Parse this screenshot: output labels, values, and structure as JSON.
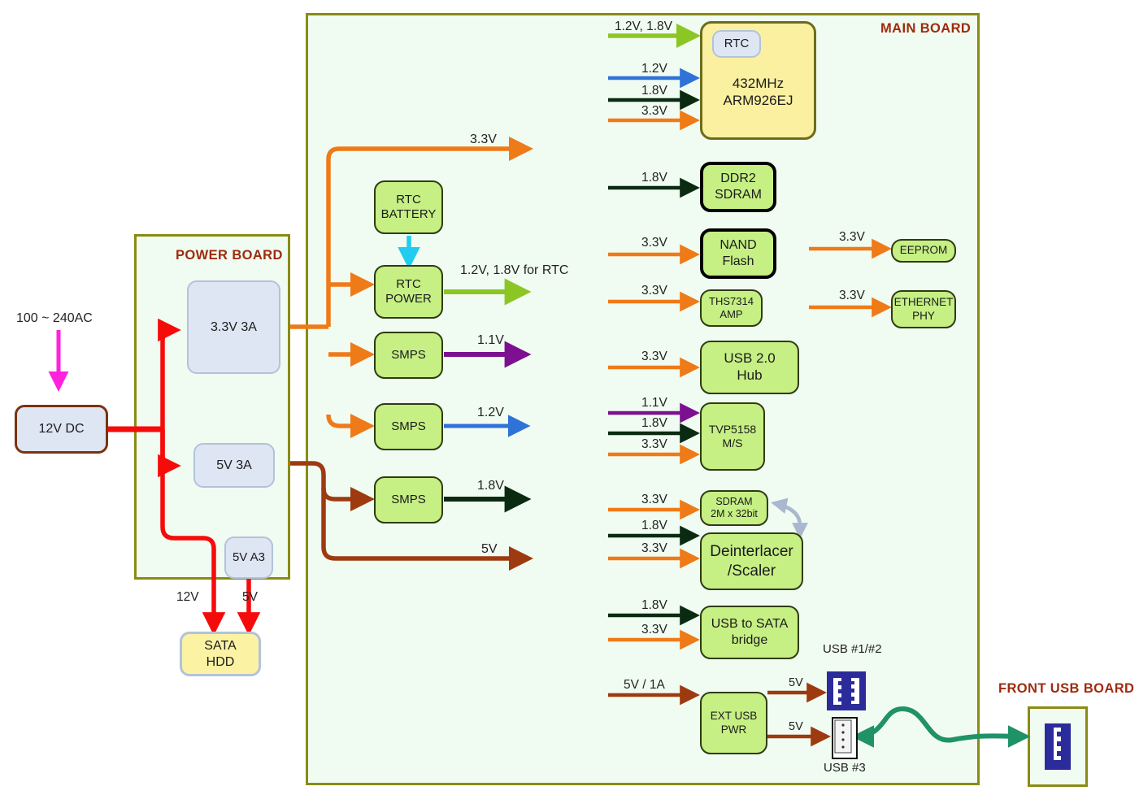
{
  "diagram": {
    "title": "Power distribution block diagram",
    "boards": [
      {
        "id": "power-board",
        "label": "POWER BOARD"
      },
      {
        "id": "main-board",
        "label": "MAIN BOARD"
      },
      {
        "id": "front-usb-board",
        "label": "FRONT  USB BOARD"
      }
    ]
  },
  "input": {
    "ac_label": "100 ~ 240AC",
    "dc_brick": "12V DC"
  },
  "power_board": {
    "rail_3v3": "3.3V 3A",
    "rail_5v": "5V 3A",
    "rail_5v_a3": "5V A3",
    "out_12v": "12V",
    "out_5v": "5V",
    "sata": {
      "line1": "SATA",
      "line2": "HDD"
    }
  },
  "main_board": {
    "regulators": [
      {
        "name": "rtc-battery",
        "line1": "RTC",
        "line2": "BATTERY",
        "out": ""
      },
      {
        "name": "rtc-power",
        "line1": "RTC",
        "line2": "POWER",
        "out": "1.2V, 1.8V for RTC"
      },
      {
        "name": "smps-1v1",
        "line1": "SMPS",
        "line2": "",
        "out": "1.1V"
      },
      {
        "name": "smps-1v2",
        "line1": "SMPS",
        "line2": "",
        "out": "1.2V"
      },
      {
        "name": "smps-1v8",
        "line1": "SMPS",
        "line2": "",
        "out": "1.8V"
      }
    ],
    "bus_3v3": "3.3V",
    "bus_5v": "5V",
    "cpu": {
      "rtc_tag": "RTC",
      "line1": "432MHz",
      "line2": "ARM926EJ",
      "rails": [
        "1.2V, 1.8V",
        "1.2V",
        "1.8V",
        "3.3V"
      ]
    },
    "ddr2": {
      "line1": "DDR2",
      "line2": "SDRAM",
      "rail": "1.8V"
    },
    "nand": {
      "line1": "NAND",
      "line2": "Flash",
      "rail": "3.3V"
    },
    "ths": {
      "line1": "THS7314",
      "line2": "AMP",
      "rail": "3.3V"
    },
    "eeprom": {
      "line1": "EEPROM",
      "rail": "3.3V"
    },
    "ethphy": {
      "line1": "ETHERNET",
      "line2": "PHY",
      "rail": "3.3V"
    },
    "usbhub": {
      "line1": "USB 2.0",
      "line2": "Hub",
      "rail": "3.3V"
    },
    "tvp": {
      "line1": "TVP5158",
      "line2": "M/S",
      "rails": [
        "1.1V",
        "1.8V",
        "3.3V"
      ]
    },
    "sdram2m": {
      "line1": "SDRAM",
      "line2": "2M x 32bit",
      "rail": "3.3V"
    },
    "scaler": {
      "line1": "Deinterlacer",
      "line2": "/Scaler",
      "rails": [
        "1.8V",
        "3.3V"
      ]
    },
    "usbsata": {
      "line1": "USB to SATA",
      "line2": "bridge",
      "rails": [
        "1.8V",
        "3.3V"
      ]
    },
    "extusb": {
      "line1": "EXT USB",
      "line2": "PWR",
      "rail_in": "5V / 1A",
      "rail_out_1": "5V",
      "rail_out_2": "5V"
    },
    "usb12_label": "USB #1/#2",
    "usb3_label": "USB #3"
  },
  "colors": {
    "orange_3v3": "#ef7a18",
    "darkred_5v": "#9e3a10",
    "red_12v": "#f60b0b",
    "magenta_ac": "#ff22dd",
    "green_rtc": "#8cc624",
    "blue_1v2": "#2f72d8",
    "darkgreen_1v8": "#0b2a12",
    "purple_1v1": "#7c1090",
    "cyan_batt": "#22ccf0",
    "teal_cable": "#1f9268",
    "board_border": "#8a8b12",
    "board_fill": "#f0fbf1",
    "board_title": "#9e2b0e"
  }
}
